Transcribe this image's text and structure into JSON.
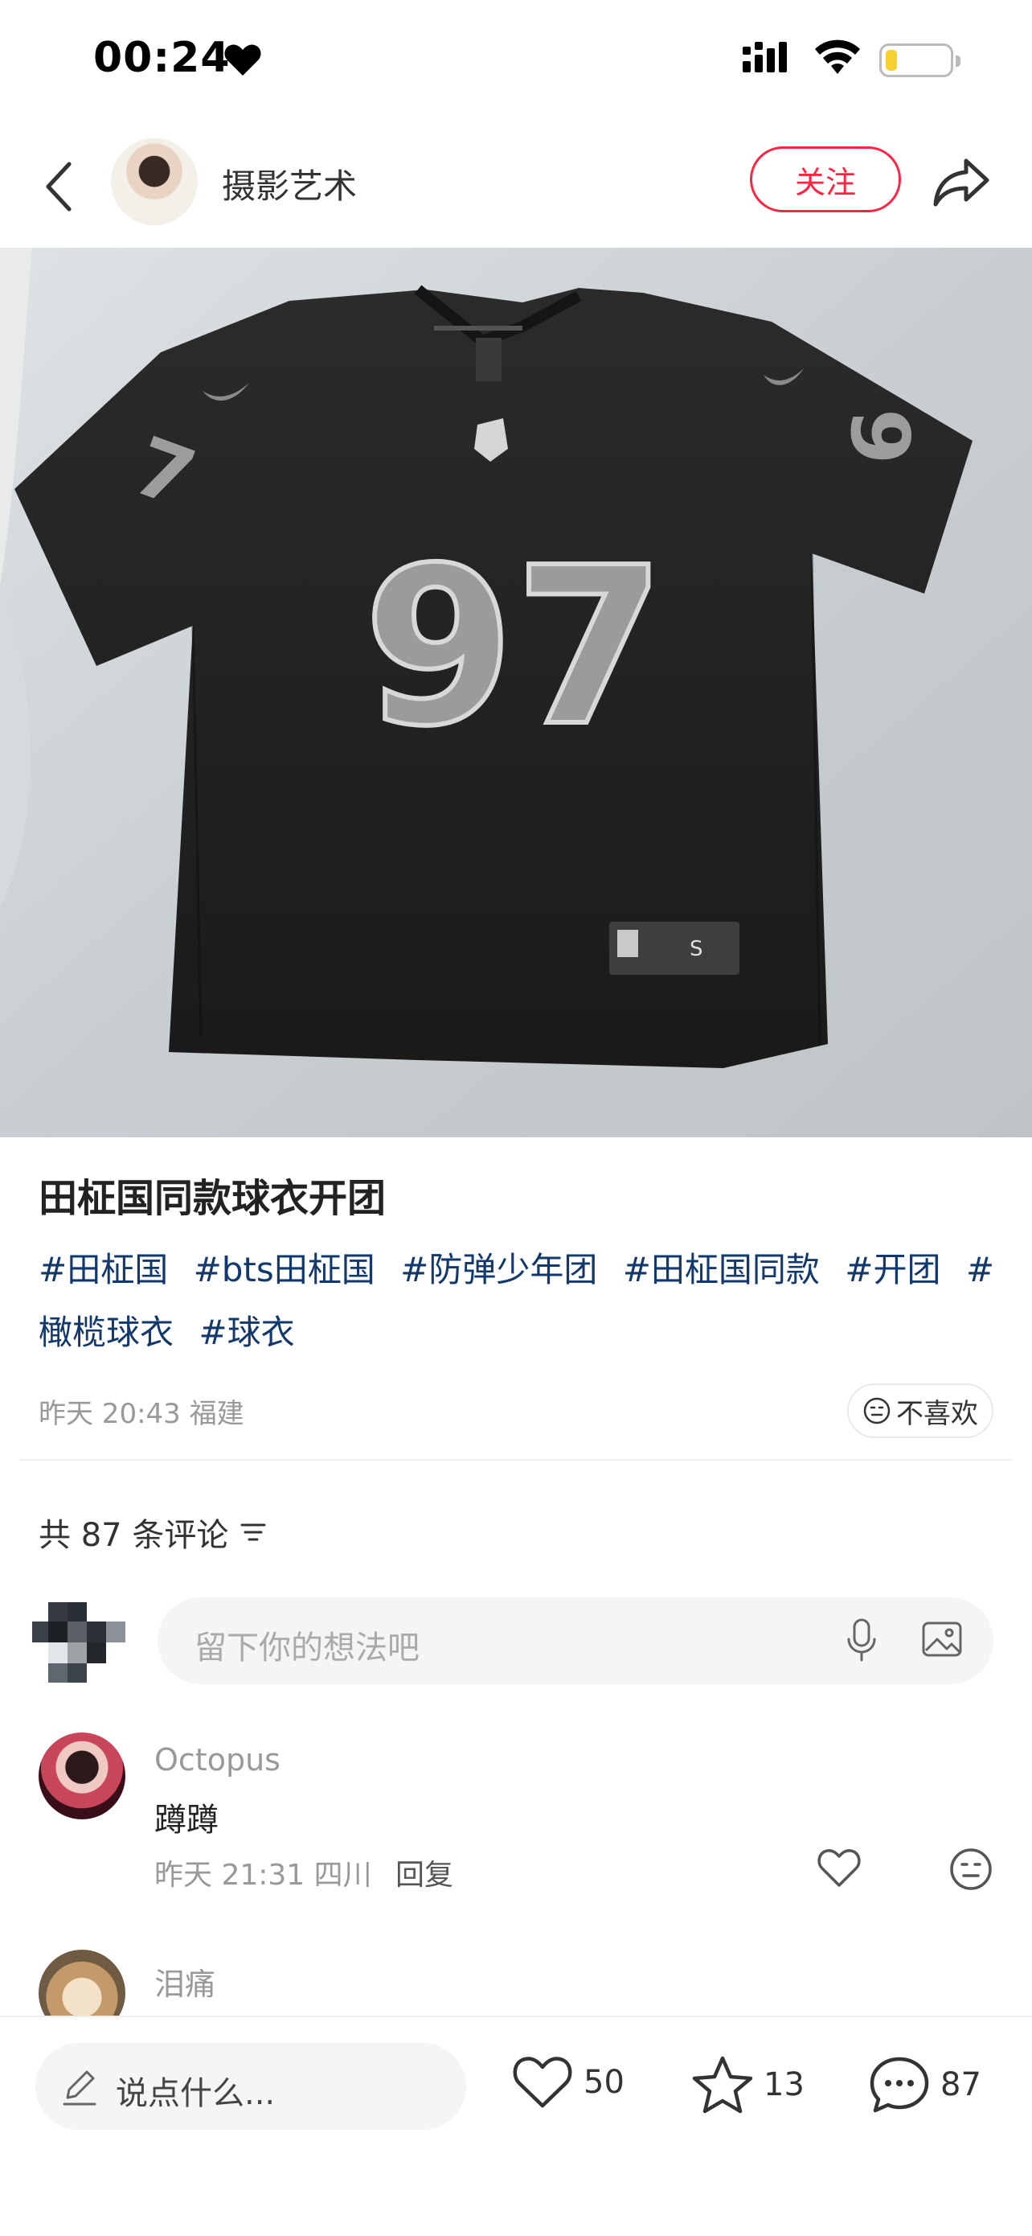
{
  "status_bar": {
    "time": "00:24"
  },
  "header": {
    "author_name": "摄影艺术",
    "follow_label": "关注"
  },
  "post": {
    "title": "田柾国同款球衣开团",
    "tags": [
      "#田柾国",
      "#bts田柾国",
      "#防弹少年团",
      "#田柾国同款",
      "#开团",
      "#橄榄球衣",
      "#球衣"
    ],
    "date_location": "昨天 20:43 福建",
    "dislike_label": "不喜欢",
    "jersey_number": "97"
  },
  "comments_section": {
    "count_label": "共 87 条评论",
    "input_placeholder": "留下你的想法吧",
    "comments": [
      {
        "name": "Octopus",
        "text": "蹲蹲",
        "meta": "昨天 21:31 四川",
        "reply_label": "回复"
      },
      {
        "name": "泪痛",
        "text": ""
      }
    ]
  },
  "bottom_bar": {
    "input_placeholder": "说点什么...",
    "likes": "50",
    "favorites": "13",
    "comments": "87"
  },
  "colors": {
    "accent": "#ff2442",
    "tag": "#13386c",
    "muted": "#999999"
  }
}
